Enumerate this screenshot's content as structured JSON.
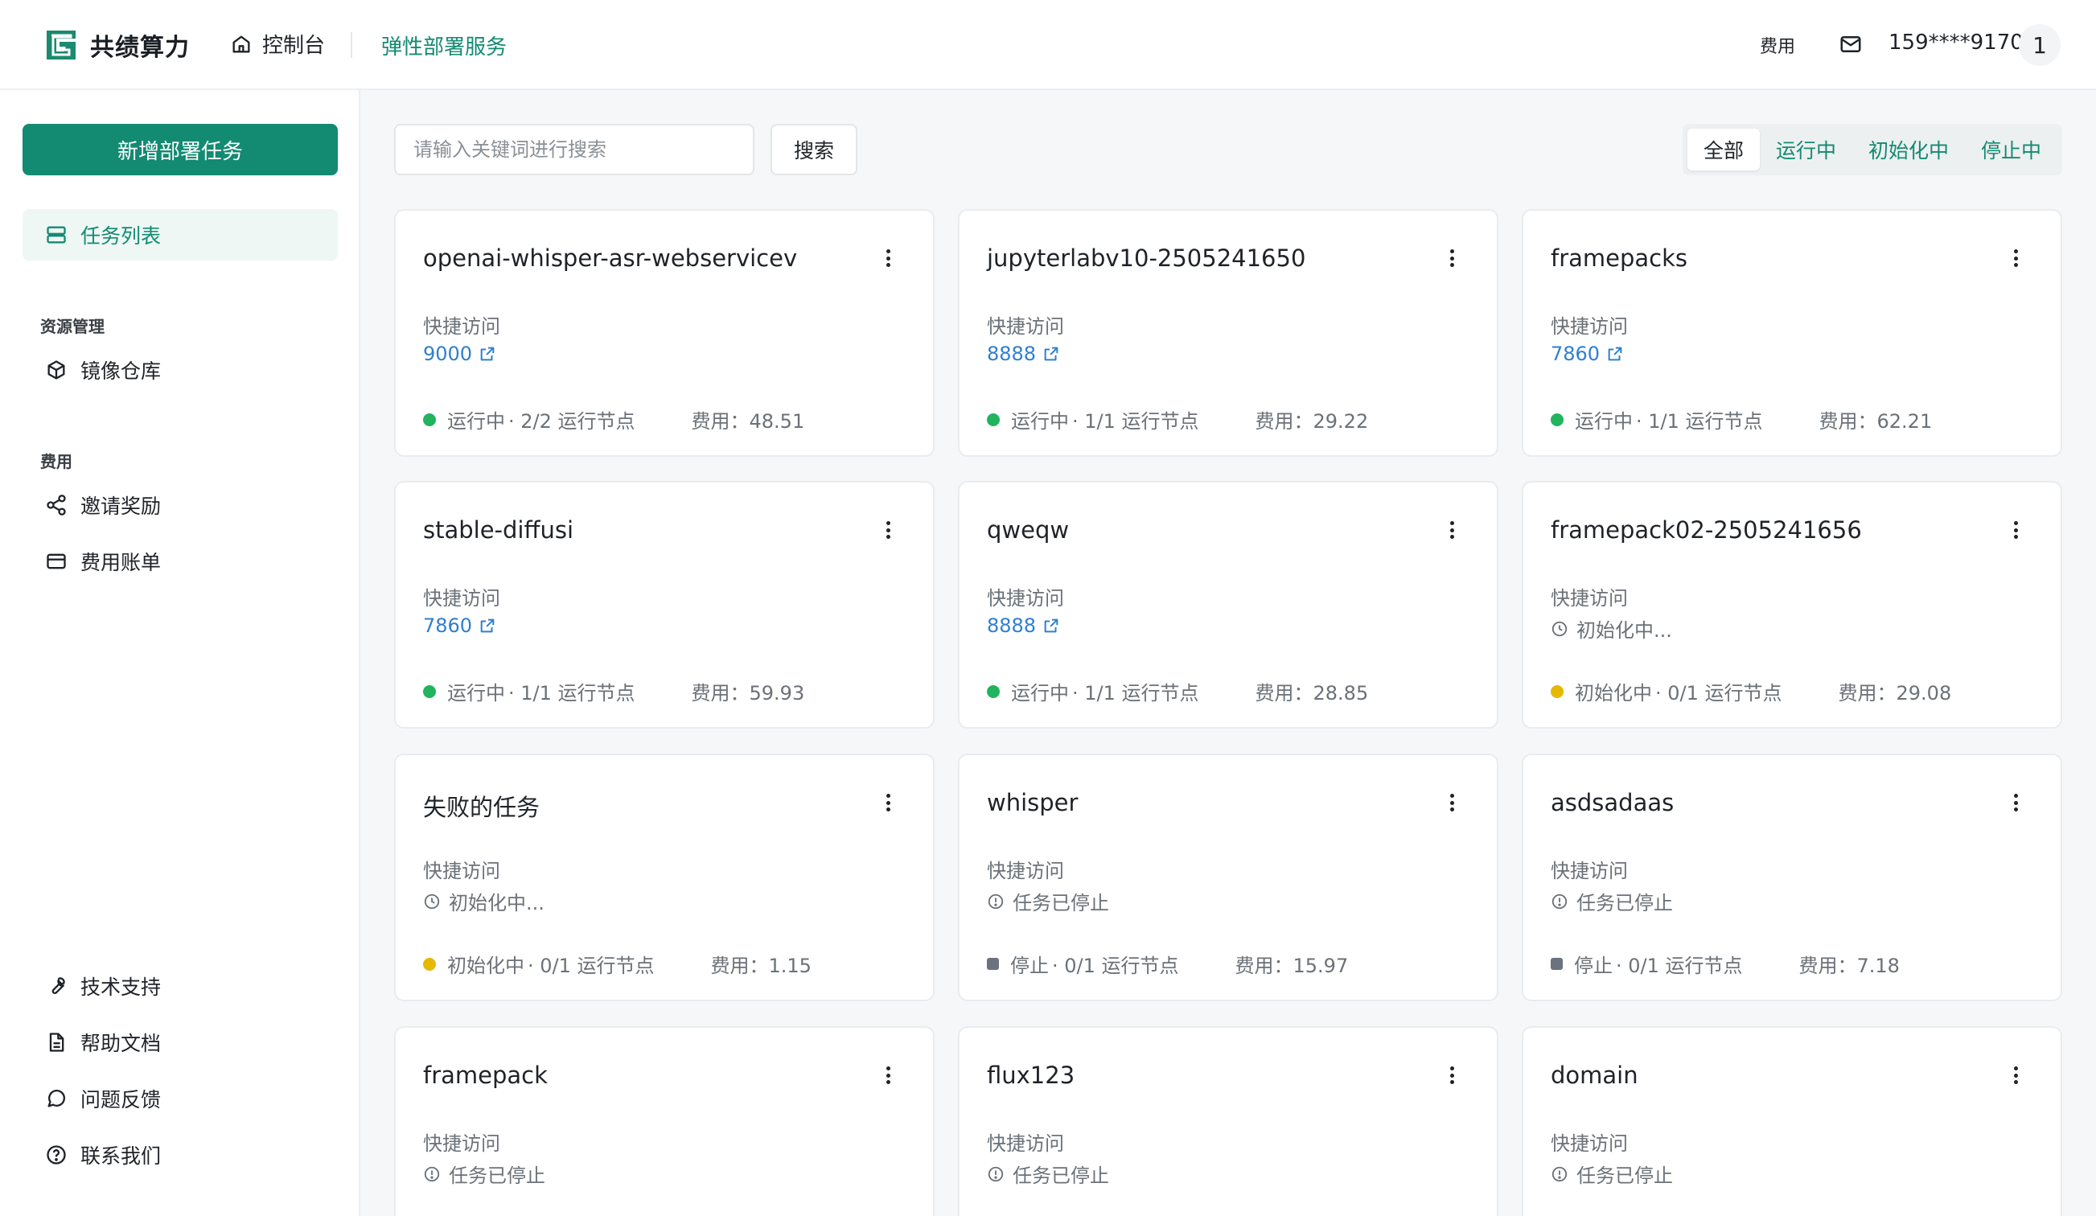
{
  "header": {
    "brand": "共绩算力",
    "console": "控制台",
    "elastic": "弹性部署服务",
    "fee": "费用",
    "phone": "159****9170",
    "avatar": "1"
  },
  "sidebar": {
    "new_button": "新增部署任务",
    "task_list": "任务列表",
    "section_resources": "资源管理",
    "image_repo": "镜像仓库",
    "section_fee": "费用",
    "invite": "邀请奖励",
    "billing": "费用账单",
    "support": "技术支持",
    "docs": "帮助文档",
    "feedback": "问题反馈",
    "contact": "联系我们"
  },
  "toolbar": {
    "search_placeholder": "请输入关键词进行搜索",
    "search_button": "搜索",
    "filters": [
      "全部",
      "运行中",
      "初始化中",
      "停止中"
    ]
  },
  "colors": {
    "brand": "#138a72",
    "running": "#22b35e",
    "initializing": "#e6b800",
    "stopped": "#6b7280",
    "link": "#2f7fd0"
  },
  "cards": [
    {
      "title": "openai-whisper-asr-webservicev",
      "access_label": "快捷访问",
      "link": "9000",
      "status": "运行中",
      "nodes": "· 2/2 运行节点",
      "fee": "费用：48.51"
    },
    {
      "title": "jupyterlabv10-2505241650",
      "access_label": "快捷访问",
      "link": "8888",
      "status": "运行中",
      "nodes": "· 1/1 运行节点",
      "fee": "费用：29.22"
    },
    {
      "title": "framepacks",
      "access_label": "快捷访问",
      "link": "7860",
      "status": "运行中",
      "nodes": "· 1/1 运行节点",
      "fee": "费用：62.21"
    },
    {
      "title": "stable-diffusi",
      "access_label": "快捷访问",
      "link": "7860",
      "status": "运行中",
      "nodes": "· 1/1 运行节点",
      "fee": "费用：59.93"
    },
    {
      "title": "qweqw",
      "access_label": "快捷访问",
      "link": "8888",
      "status": "运行中",
      "nodes": "· 1/1 运行节点",
      "fee": "费用：28.85"
    },
    {
      "title": "framepack02-2505241656",
      "access_label": "快捷访问",
      "state": "初始化中...",
      "status": "初始化中",
      "nodes": "· 0/1 运行节点",
      "fee": "费用：29.08"
    },
    {
      "title": "失败的任务",
      "access_label": "快捷访问",
      "state": "初始化中...",
      "status": "初始化中",
      "nodes": "· 0/1 运行节点",
      "fee": "费用：1.15"
    },
    {
      "title": "whisper",
      "access_label": "快捷访问",
      "state": "任务已停止",
      "status": "停止",
      "nodes": "· 0/1 运行节点",
      "fee": "费用：15.97"
    },
    {
      "title": "asdsadaas",
      "access_label": "快捷访问",
      "state": "任务已停止",
      "status": "停止",
      "nodes": "· 0/1 运行节点",
      "fee": "费用：7.18"
    },
    {
      "title": "framepack",
      "access_label": "快捷访问",
      "state": "任务已停止"
    },
    {
      "title": "flux123",
      "access_label": "快捷访问",
      "state": "任务已停止"
    },
    {
      "title": "domain",
      "access_label": "快捷访问",
      "state": "任务已停止"
    }
  ]
}
